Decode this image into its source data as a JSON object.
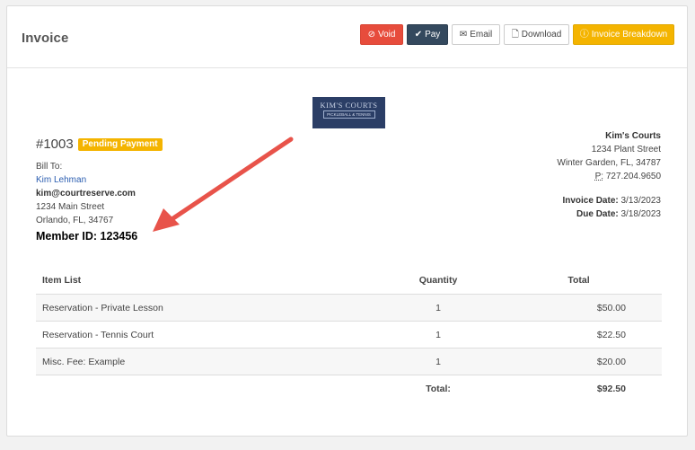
{
  "header": {
    "title": "Invoice",
    "buttons": {
      "void": "Void",
      "pay": "Pay",
      "email": "Email",
      "download": "Download",
      "breakdown": "Invoice Breakdown"
    }
  },
  "logo": {
    "name": "KIM'S COURTS",
    "tagline": "PICKLEBALL & TENNIS"
  },
  "invoice": {
    "number": "#1003",
    "status": "Pending Payment"
  },
  "bill_to": {
    "label": "Bill To:",
    "name": "Kim Lehman",
    "email": "kim@courtreserve.com",
    "street": "1234 Main Street",
    "city": "Orlando, FL, 34767",
    "member_id": "Member ID: 123456"
  },
  "company": {
    "name": "Kim's Courts",
    "street": "1234 Plant Street",
    "city": "Winter Garden, FL, 34787",
    "phone_label": "P:",
    "phone": "727.204.9650",
    "invoice_date_label": "Invoice Date:",
    "invoice_date": "3/13/2023",
    "due_date_label": "Due Date:",
    "due_date": "3/18/2023"
  },
  "table": {
    "headers": {
      "item": "Item List",
      "qty": "Quantity",
      "total": "Total"
    },
    "rows": [
      {
        "item": "Reservation - Private Lesson",
        "qty": "1",
        "total": "$50.00"
      },
      {
        "item": "Reservation - Tennis Court",
        "qty": "1",
        "total": "$22.50"
      },
      {
        "item": "Misc. Fee: Example",
        "qty": "1",
        "total": "$20.00"
      }
    ],
    "total_label": "Total:",
    "total_value": "$92.50"
  },
  "colors": {
    "void": "#e74c3c",
    "pay": "#34495e",
    "breakdown": "#f4b400",
    "badge": "#f4b400",
    "arrow": "#e8534a"
  }
}
